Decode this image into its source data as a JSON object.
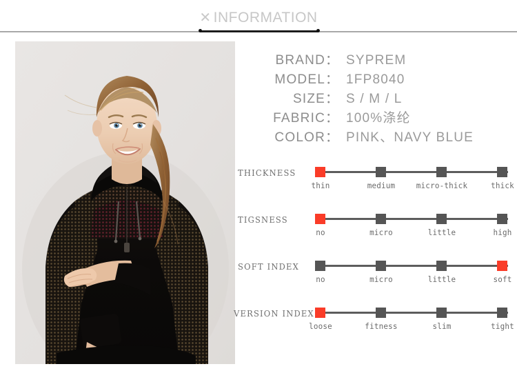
{
  "header": {
    "x_mark": "✕",
    "title": "INFORMATION"
  },
  "photo": {
    "alt_name": "product-photo-model-black-mesh-hoodie"
  },
  "specs": [
    {
      "key": "BRAND",
      "colon": "：",
      "value": "SYPREM"
    },
    {
      "key": "MODEL",
      "colon": "：",
      "value": "1FP8040"
    },
    {
      "key": "SIZE",
      "colon": "：",
      "value": "S / M / L"
    },
    {
      "key": "FABRIC",
      "colon": "：",
      "value": "100%涤纶"
    },
    {
      "key": "COLOR",
      "colon": "：",
      "value": "PINK、NAVY BLUE"
    }
  ],
  "scales": [
    {
      "label": "THICKNESS",
      "selected_index": 1,
      "options": [
        "thin",
        "medium",
        "micro-thick",
        "thick"
      ]
    },
    {
      "label": "TIGSNESS",
      "selected_index": 0,
      "options": [
        "no",
        "micro",
        "little",
        "high"
      ]
    },
    {
      "label": "SOFT INDEX",
      "selected_index": 3,
      "options": [
        "no",
        "micro",
        "little",
        "soft"
      ]
    },
    {
      "label": "VERSION INDEX",
      "selected_index": 0,
      "options": [
        "loose",
        "fitness",
        "slim",
        "tight"
      ]
    }
  ],
  "colors": {
    "accent_selected": "#fa3c28",
    "node_inactive": "#555555",
    "track_line": "#5c5c5c",
    "spec_text": "#8d8d8d",
    "scale_label": "#6e6e6e",
    "header_title": "#c7c7c7",
    "header_rule_dark": "#1c1c1c",
    "header_rule_light": "#a8a8a8",
    "photo_background": "#e4e1df"
  }
}
